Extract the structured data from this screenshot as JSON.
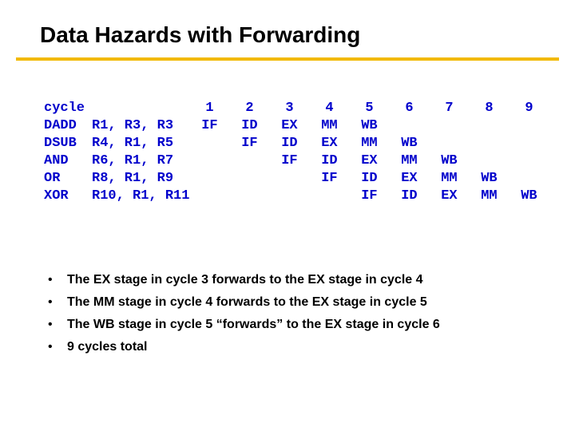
{
  "title": "Data Hazards with Forwarding",
  "table": {
    "header_label": "cycle",
    "cycles": [
      "1",
      "2",
      "3",
      "4",
      "5",
      "6",
      "7",
      "8",
      "9"
    ],
    "rows": [
      {
        "instr": "DADD",
        "ops": "R1, R3, R3",
        "stages": [
          "IF",
          "ID",
          "EX",
          "MM",
          "WB",
          "",
          "",
          "",
          ""
        ]
      },
      {
        "instr": "DSUB",
        "ops": "R4, R1, R5",
        "stages": [
          "",
          "IF",
          "ID",
          "EX",
          "MM",
          "WB",
          "",
          "",
          ""
        ]
      },
      {
        "instr": "AND",
        "ops": "R6, R1, R7",
        "stages": [
          "",
          "",
          "IF",
          "ID",
          "EX",
          "MM",
          "WB",
          "",
          ""
        ]
      },
      {
        "instr": "OR",
        "ops": "R8, R1, R9",
        "stages": [
          "",
          "",
          "",
          "IF",
          "ID",
          "EX",
          "MM",
          "WB",
          ""
        ]
      },
      {
        "instr": "XOR",
        "ops": "R10, R1, R11",
        "stages": [
          "",
          "",
          "",
          "",
          "IF",
          "ID",
          "EX",
          "MM",
          "WB"
        ]
      }
    ]
  },
  "bullets": [
    "The EX stage in cycle 3 forwards to the EX stage in cycle 4",
    "The MM stage in cycle 4 forwards to the EX stage in cycle 5",
    "The WB stage in cycle 5 “forwards” to the EX stage in cycle 6",
    "9 cycles total"
  ]
}
